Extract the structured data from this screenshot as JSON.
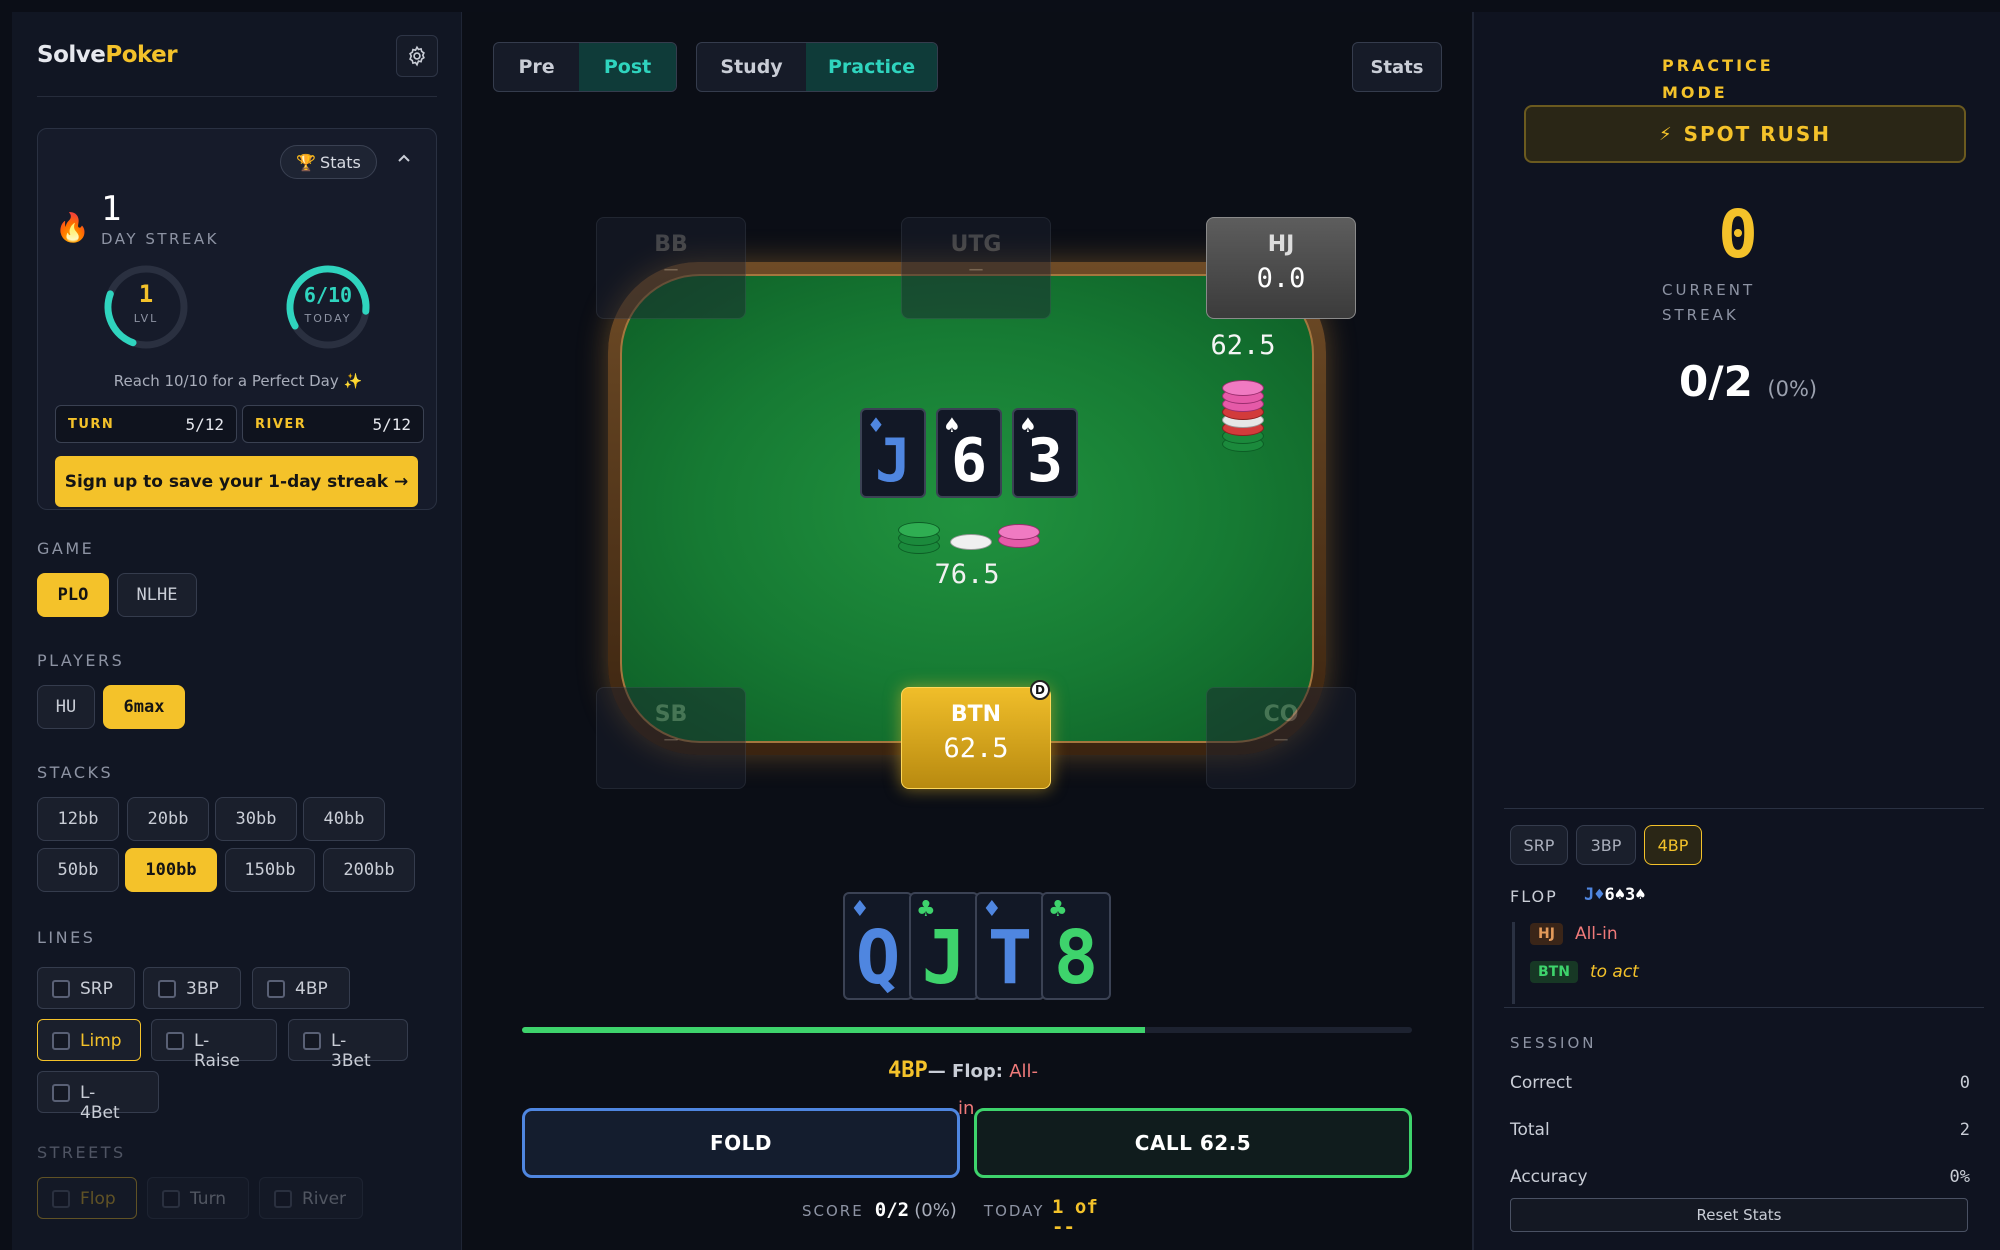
{
  "brand": {
    "solve": "Solve",
    "poker": "Poker"
  },
  "streak_card": {
    "stats_label": "Stats",
    "trophy": "🏆",
    "flame": "🔥",
    "streak_value": "1",
    "streak_label": "DAY STREAK",
    "level_value": "1",
    "level_label": "LVL",
    "level_progress": 0.25,
    "today_value": "6/10",
    "today_label": "TODAY",
    "today_progress": 0.6,
    "perfect_text": "Reach 10/10 for a Perfect Day ✨",
    "turn_label": "TURN",
    "turn_value": "5/12",
    "river_label": "RIVER",
    "river_value": "5/12",
    "signup_label": "Sign up to save your 1-day streak →"
  },
  "filters": {
    "game_title": "GAME",
    "game_options": [
      "PLO",
      "NLHE"
    ],
    "game_selected": "PLO",
    "players_title": "PLAYERS",
    "players_options": [
      "HU",
      "6max"
    ],
    "players_selected": "6max",
    "stacks_title": "STACKS",
    "stacks_options": [
      "12bb",
      "20bb",
      "30bb",
      "40bb",
      "50bb",
      "100bb",
      "150bb",
      "200bb"
    ],
    "stacks_selected": "100bb",
    "lines_title": "LINES",
    "lines_options": [
      "SRP",
      "3BP",
      "4BP",
      "Limp",
      "L-\nRaise",
      "L-\n3Bet",
      "L-\n4Bet"
    ],
    "lines_selected": "Limp",
    "streets_title": "STREETS",
    "streets_options": [
      "Flop",
      "Turn",
      "River"
    ],
    "streets_selected": "Flop"
  },
  "topbar": {
    "pre": "Pre",
    "post": "Post",
    "study": "Study",
    "practice": "Practice",
    "stats": "Stats"
  },
  "seats": [
    {
      "pos": "BB",
      "stack": "—",
      "state": "inactive"
    },
    {
      "pos": "UTG",
      "stack": "—",
      "state": "inactive"
    },
    {
      "pos": "HJ",
      "stack": "0.0",
      "state": "active"
    },
    {
      "pos": "SB",
      "stack": "—",
      "state": "inactive"
    },
    {
      "pos": "BTN",
      "stack": "62.5",
      "state": "hero"
    },
    {
      "pos": "CO",
      "stack": "—",
      "state": "inactive"
    }
  ],
  "dealer": "D",
  "hj_bet": "62.5",
  "board": [
    {
      "rank": "J",
      "suit": "♦",
      "color": "#4f86e0"
    },
    {
      "rank": "6",
      "suit": "♠",
      "color": "#ffffff"
    },
    {
      "rank": "3",
      "suit": "♠",
      "color": "#ffffff"
    }
  ],
  "pot": "76.5",
  "hand": [
    {
      "rank": "Q",
      "suit": "♦",
      "color": "#4f86e0"
    },
    {
      "rank": "J",
      "suit": "♣",
      "color": "#3ed36c"
    },
    {
      "rank": "T",
      "suit": "♦",
      "color": "#4f86e0"
    },
    {
      "rank": "8",
      "suit": "♣",
      "color": "#3ed36c"
    }
  ],
  "progress": 0.7,
  "spot_line": {
    "tag": "4BP",
    "sep": "— Flop: ",
    "action1": "All-",
    "action2": "in"
  },
  "actions": {
    "fold": "FOLD",
    "call": "CALL 62.5"
  },
  "footer": {
    "score_label": "SCORE",
    "score_value": "0/2",
    "score_pct": "(0%)",
    "today_label": "TODAY",
    "today_value1": "1 of",
    "today_value2": "--"
  },
  "right": {
    "mode1": "PRACTICE",
    "mode2": "MODE",
    "spot_rush": "SPOT RUSH",
    "bolt": "⚡",
    "current_streak": "0",
    "current_label1": "CURRENT",
    "current_label2": "STREAK",
    "ratio": "0/2",
    "ratio_pct": "(0%)",
    "pot_types": [
      "SRP",
      "3BP",
      "4BP"
    ],
    "pot_selected": "4BP",
    "flop_label": "FLOP",
    "flop_cards": [
      {
        "t": "J",
        "c": "#4f86e0"
      },
      {
        "t": "♦",
        "c": "#4f86e0"
      },
      {
        "t": "6",
        "c": "#ffffff"
      },
      {
        "t": "♠",
        "c": "#ffffff"
      },
      {
        "t": "3",
        "c": "#ffffff"
      },
      {
        "t": "♠",
        "c": "#ffffff"
      }
    ],
    "line1_pos": "HJ",
    "line1_act": "All-in",
    "line2_pos": "BTN",
    "line2_act": "to act",
    "session_title": "SESSION",
    "correct_label": "Correct",
    "correct_value": "0",
    "total_label": "Total",
    "total_value": "2",
    "accuracy_label": "Accuracy",
    "accuracy_value": "0%",
    "reset_label": "Reset Stats"
  },
  "colors": {
    "accent": "#f4c22a",
    "teal": "#2fd4be",
    "green": "#3ed36c",
    "blue": "#4f86e0",
    "allin": "#f07a7a"
  }
}
